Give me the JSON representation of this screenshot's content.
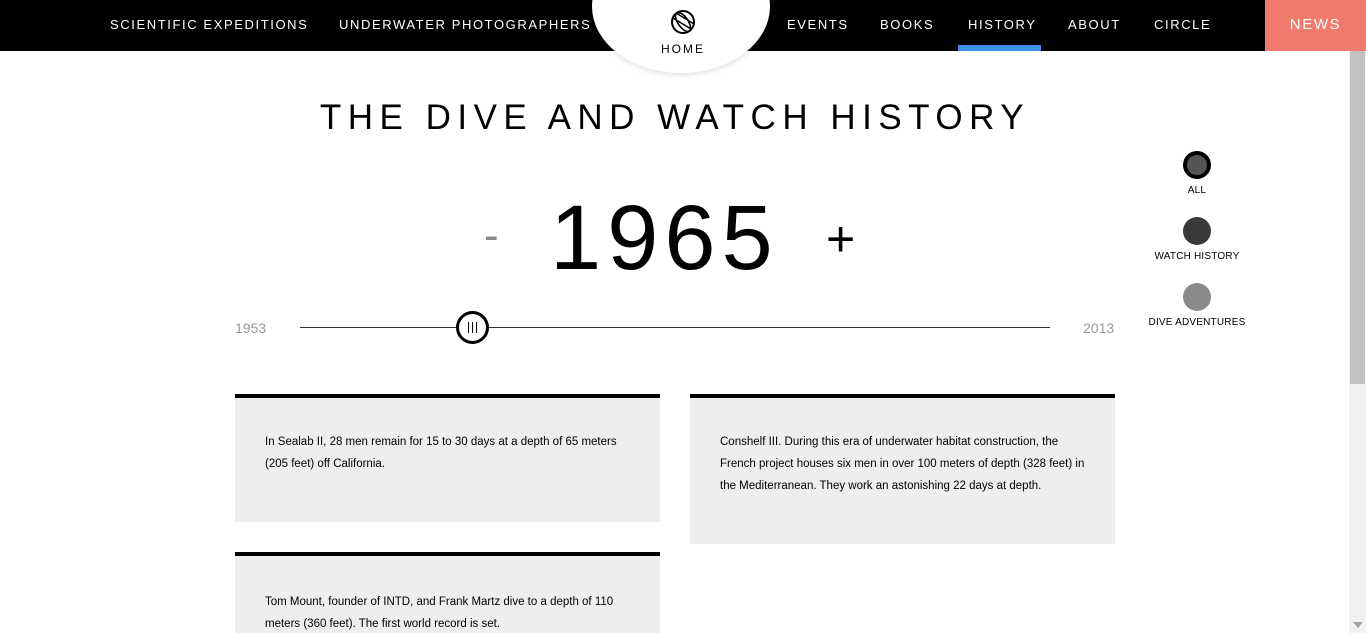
{
  "nav": {
    "left_items": [
      "SCIENTIFIC EXPEDITIONS",
      "UNDERWATER PHOTOGRAPHERS"
    ],
    "home_label": "HOME",
    "right_items": [
      "EVENTS",
      "BOOKS",
      "HISTORY",
      "ABOUT",
      "CIRCLE"
    ],
    "active_item": "HISTORY",
    "news_label": "NEWS",
    "colors": {
      "bar": "#000000",
      "active_indicator": "#3b8fe6",
      "news_bg": "#f07b6d"
    },
    "home_icon": "globe-icon"
  },
  "title": "THE DIVE AND WATCH HISTORY",
  "year_selector": {
    "minus_label": "-",
    "year": "1965",
    "plus_label": "+"
  },
  "timeline": {
    "min_label": "1953",
    "max_label": "2013",
    "value": 1965
  },
  "filters": [
    {
      "label": "ALL",
      "color": "#555555",
      "selected": true
    },
    {
      "label": "WATCH HISTORY",
      "color": "#3a3a3a",
      "selected": false
    },
    {
      "label": "DIVE ADVENTURES",
      "color": "#8a8a8a",
      "selected": false
    }
  ],
  "events": [
    {
      "text": "In Sealab II, 28 men remain for 15 to 30 days at a depth of 65 meters (205 feet) off California."
    },
    {
      "text": "Conshelf III. During this era of underwater habitat construction, the French project houses six men in over 100 meters of depth (328 feet) in the Mediterranean. They work an astonishing 22 days at depth."
    },
    {
      "text": "Tom Mount, founder of INTD, and Frank Martz dive to a depth of 110 meters (360 feet). The first world record is set."
    }
  ]
}
